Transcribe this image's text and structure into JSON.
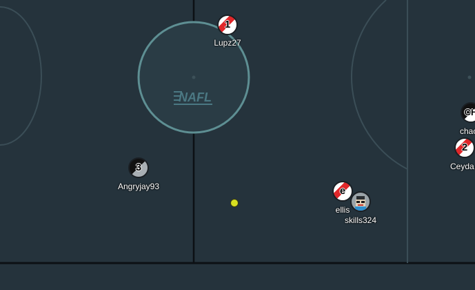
{
  "field": {
    "background": "#25333c",
    "line_color": "#0f1418",
    "circle_color": "#5e8f93",
    "logo_text": "NAFL"
  },
  "players": [
    {
      "id": "lupz27",
      "name": "Lupz27",
      "number": "1",
      "style": "red-white"
    },
    {
      "id": "angryjay93",
      "name": "Angryjay93",
      "number": "3",
      "style": "black-grey"
    },
    {
      "id": "ellis",
      "name": "ellis",
      "number": "e",
      "style": "red-white"
    },
    {
      "id": "skills324",
      "name": "skills324",
      "number": "",
      "style": "avatar"
    },
    {
      "id": "chad",
      "name": "chac",
      "number": "CH",
      "style": "black-white"
    },
    {
      "id": "ceyda",
      "name": "Ceyda",
      "number": "2",
      "style": "red-white"
    }
  ],
  "colors": {
    "team_red": "#e0272a",
    "team_black": "#111111",
    "team_grey": "#a9afb4",
    "ball": "#d8e021"
  }
}
